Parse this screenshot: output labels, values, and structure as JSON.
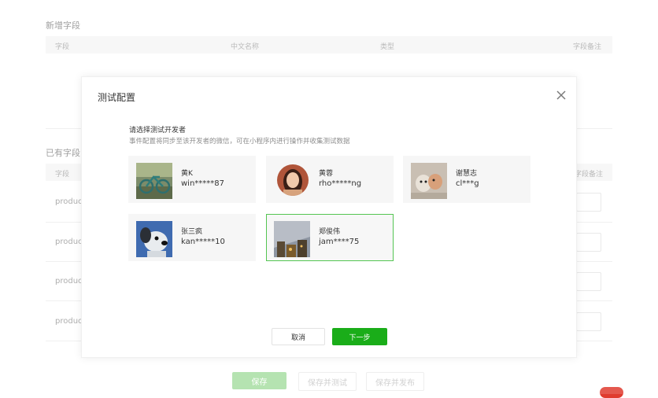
{
  "background": {
    "new_fields": {
      "title": "新增字段",
      "columns": [
        "字段",
        "中文名称",
        "类型",
        "字段备注"
      ]
    },
    "existing_fields": {
      "title": "已有字段",
      "columns": [
        "字段",
        "字段备注"
      ],
      "rows": [
        "produc",
        "produc",
        "produc",
        "produc"
      ]
    },
    "buttons": {
      "save": "保存",
      "save_test": "保存并测试",
      "save_publish": "保存并发布"
    }
  },
  "dialog": {
    "title": "测试配置",
    "heading": "请选择测试开发者",
    "description": "事件配置将同步至该开发者的微信，可在小程序内进行操作并收集测试数据",
    "developers": [
      {
        "name": "黄K",
        "id": "win*****87",
        "avatar": "bicycle-photo-avatar"
      },
      {
        "name": "黄蓉",
        "id": "rho*****ng",
        "avatar": "girl-portrait-avatar"
      },
      {
        "name": "谢慧志",
        "id": "cl***g",
        "avatar": "puppy-photo-avatar"
      },
      {
        "name": "张三疯",
        "id": "kan*****10",
        "avatar": "cartoon-dog-avatar"
      },
      {
        "name": "郑俊伟",
        "id": "jam****75",
        "avatar": "city-night-avatar",
        "selected": true
      }
    ],
    "cancel_label": "取消",
    "next_label": "下一步"
  },
  "colors": {
    "primary_green": "#1aad19",
    "selected_border": "#54c552"
  }
}
